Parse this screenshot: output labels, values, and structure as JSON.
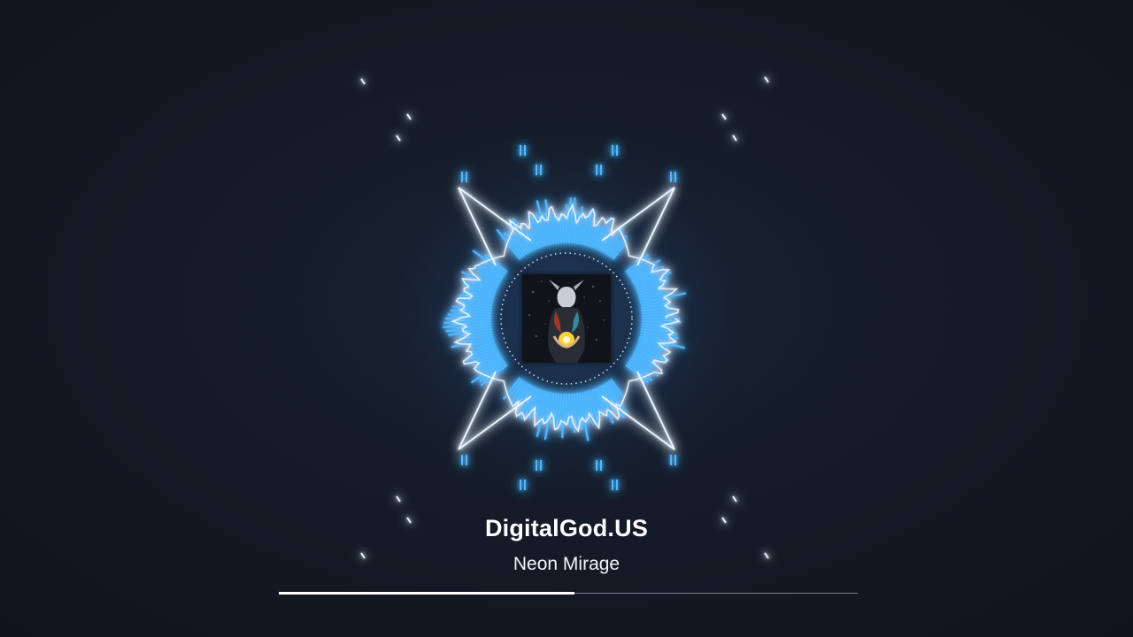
{
  "player": {
    "artist": "DigitalGod.US",
    "track": "Neon Mirage",
    "progress_fraction": 0.51
  },
  "colors": {
    "background": "#141a24",
    "glow": "#4fb8ff",
    "line": "#e8f6ff",
    "progress_fill": "#ffffff",
    "progress_track": "#8a94a6"
  },
  "icons": {
    "cover_art": "album-cover-figure-with-glowing-orb"
  }
}
